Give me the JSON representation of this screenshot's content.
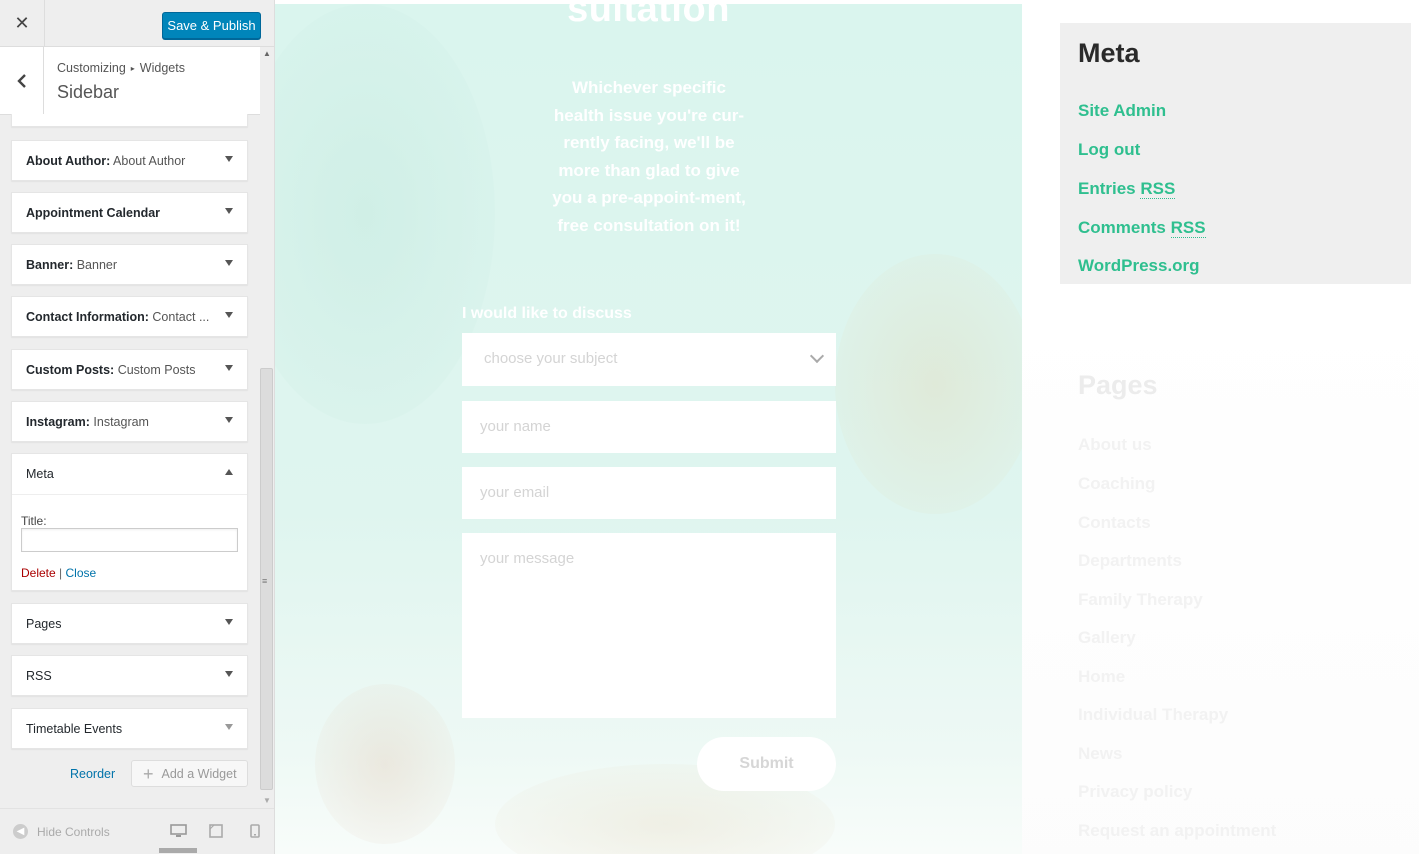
{
  "customizer": {
    "close_glyph": "✕",
    "save_label": "Save & Publish",
    "breadcrumb": [
      "Customizing",
      "Widgets"
    ],
    "breadcrumb_sep": "▸",
    "section_title": "Sidebar",
    "widgets": [
      {
        "name": "About Author:",
        "sub": "About Author"
      },
      {
        "name": "Appointment Calendar",
        "sub": ""
      },
      {
        "name": "Banner:",
        "sub": "Banner"
      },
      {
        "name": "Contact Information:",
        "sub": "Contact ..."
      },
      {
        "name": "Custom Posts:",
        "sub": "Custom Posts"
      },
      {
        "name": "Instagram:",
        "sub": "Instagram"
      },
      {
        "name": "Meta",
        "sub": ""
      },
      {
        "name": "Pages",
        "sub": ""
      },
      {
        "name": "RSS",
        "sub": ""
      },
      {
        "name": "Timetable Events",
        "sub": ""
      }
    ],
    "meta_form": {
      "title_label": "Title:",
      "title_value": "",
      "delete_label": "Delete",
      "separator": "|",
      "close_label": "Close"
    },
    "reorder_label": "Reorder",
    "add_widget_label": "Add a Widget",
    "hide_controls_label": "Hide Controls",
    "accent_color": "#0085ba",
    "scroll_grip": "≡"
  },
  "preview": {
    "hero_heading": "sultation",
    "hero_text": "Whichever specific health issue you're cur-rently facing, we'll be more than glad to give you a pre-appoint-ment, free consultation on it!",
    "discuss_label": "I would like to discuss",
    "subject_placeholder": "choose your subject",
    "name_placeholder": "your name",
    "email_placeholder": "your email",
    "message_placeholder": "your message",
    "submit_label": "Submit",
    "meta_widget": {
      "heading": "Meta",
      "links": [
        {
          "text": "Site Admin",
          "abbr": ""
        },
        {
          "text": "Log out",
          "abbr": ""
        },
        {
          "text": "Entries",
          "abbr": "RSS"
        },
        {
          "text": "Comments",
          "abbr": "RSS"
        },
        {
          "text": "WordPress.org",
          "abbr": ""
        }
      ]
    },
    "pages_widget": {
      "heading": "Pages",
      "links": [
        "About us",
        "Coaching",
        "Contacts",
        "Departments",
        "Family Therapy",
        "Gallery",
        "Home",
        "Individual Therapy",
        "News",
        "Privacy policy",
        "Request an appointment"
      ]
    },
    "link_color": "#2fbf8f"
  }
}
